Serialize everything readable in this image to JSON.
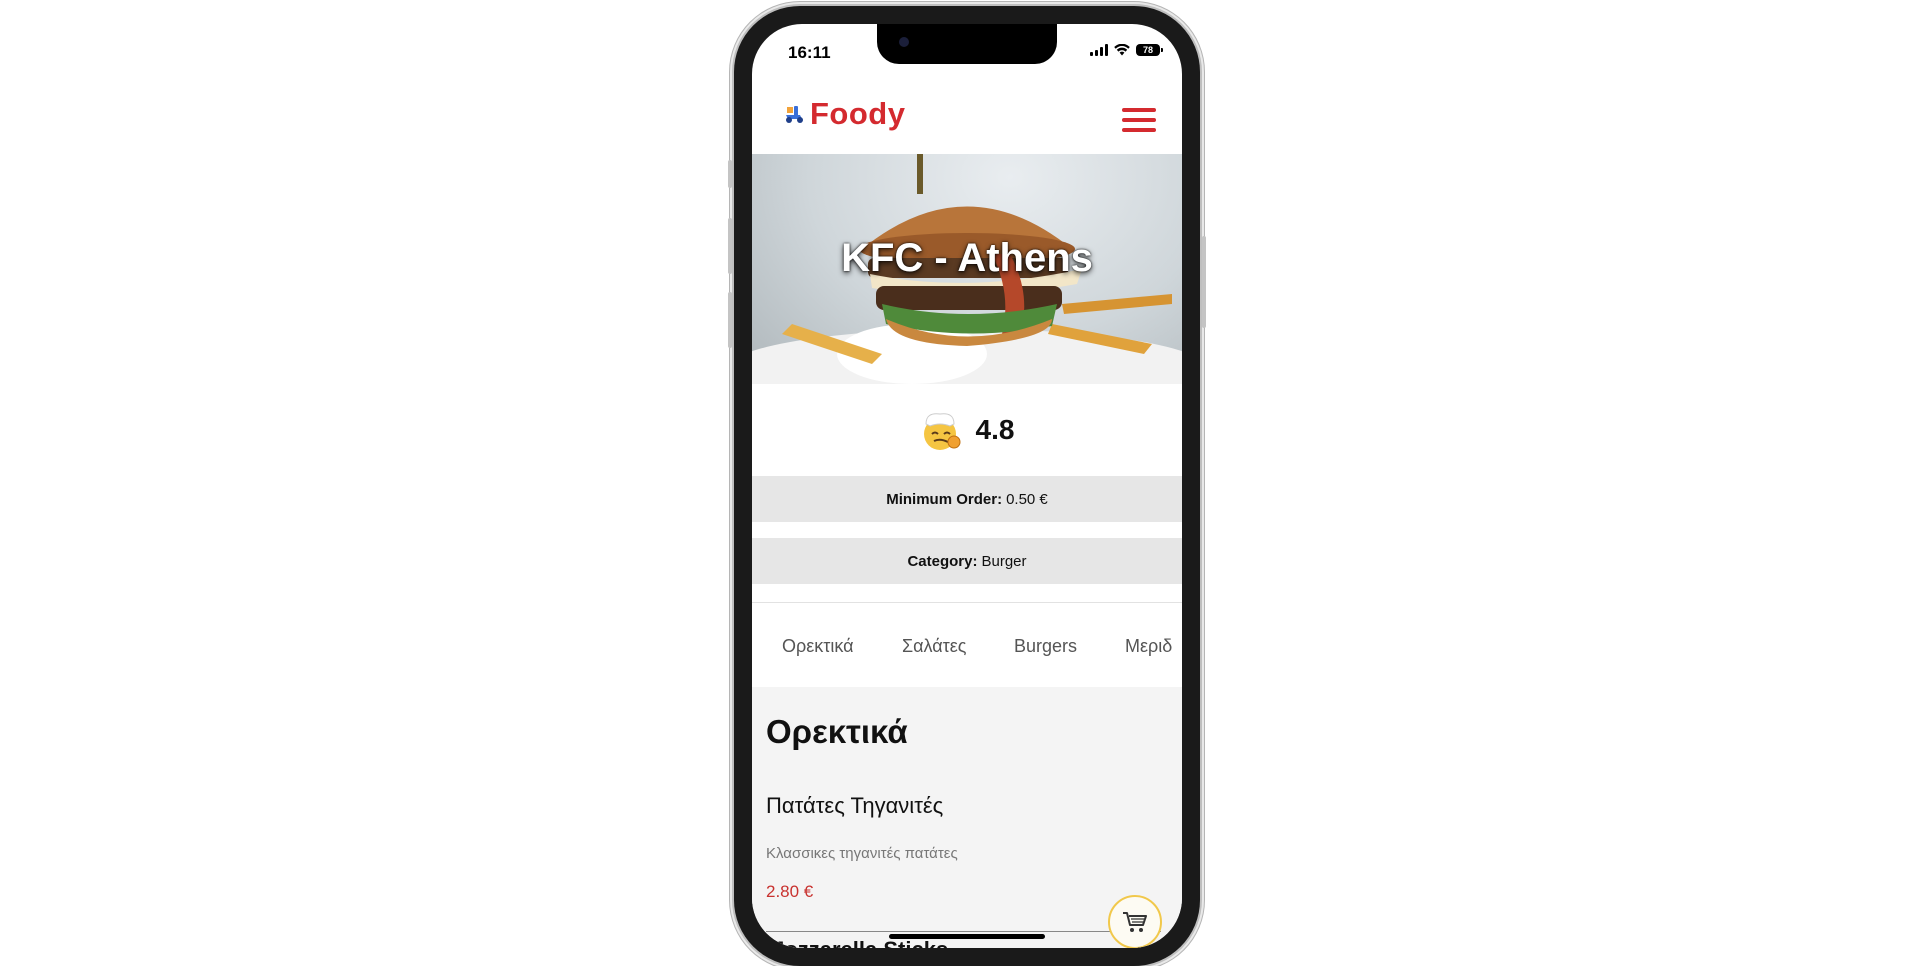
{
  "status_bar": {
    "time": "16:11",
    "battery": "78"
  },
  "header": {
    "logo_text": "Foody",
    "brand_color": "#d42a2f",
    "menu_icon": "hamburger-menu-icon"
  },
  "restaurant": {
    "name": "KFC - Athens",
    "rating": "4.8",
    "min_order_label": "Minimum Order:",
    "min_order_value": "0.50 €",
    "category_label": "Category:",
    "category_value": "Burger"
  },
  "tabs": [
    {
      "label": "Ορεκτικά"
    },
    {
      "label": "Σαλάτες"
    },
    {
      "label": "Burgers"
    },
    {
      "label": "Μεριδ"
    }
  ],
  "menu_section": {
    "title": "Ορεκτικά",
    "items": [
      {
        "name": "Πατάτες Τηγανιτές",
        "description": "Κλασσικες τηγανιτές πατάτες",
        "price": "2.80 €"
      },
      {
        "name": "Mozzarella Sticks"
      }
    ]
  },
  "cart": {
    "icon": "shopping-cart-icon"
  }
}
